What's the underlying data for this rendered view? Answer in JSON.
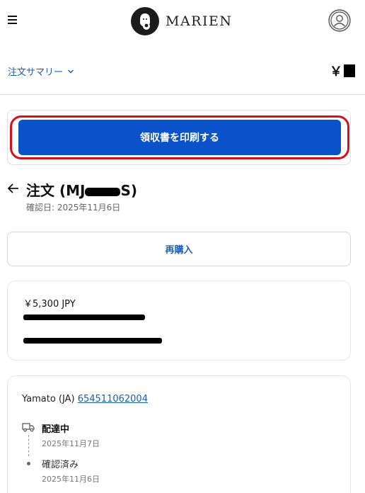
{
  "header": {
    "brand": "MARIEN"
  },
  "summary": {
    "toggle_label": "注文サマリー",
    "total_prefix": "￥"
  },
  "print_receipt": {
    "label": "領収書を印刷する"
  },
  "order": {
    "title": "注文 (MJ",
    "title_suffix": "S)",
    "confirmed_date": "確認日: 2025年11月6日"
  },
  "reorder": {
    "label": "再購入"
  },
  "payment": {
    "amount": "￥5,300 JPY"
  },
  "shipping": {
    "carrier": "Yamato (JA)",
    "tracking_number": "654511062004",
    "events": [
      {
        "status": "配達中",
        "date": "2025年11月7日"
      },
      {
        "status": "確認済み",
        "date": "2025年11月6日"
      }
    ]
  },
  "colors": {
    "primary_button": "#0a52c9",
    "link": "#1a5fb4",
    "highlight": "#d2101e"
  }
}
